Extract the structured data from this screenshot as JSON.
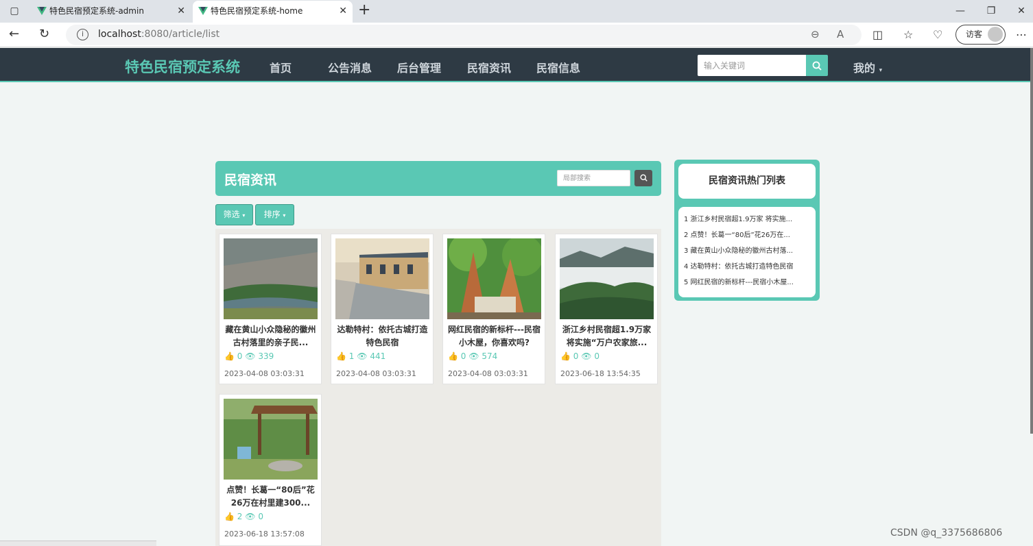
{
  "browser": {
    "tabs": [
      {
        "title": "特色民宿预定系统-admin"
      },
      {
        "title": "特色民宿预定系统-home"
      }
    ],
    "url_host": "localhost",
    "url_path": ":8080/article/list",
    "visitor_label": "访客"
  },
  "header": {
    "logo": "特色民宿预定系统",
    "nav": [
      "首页",
      "公告消息",
      "后台管理",
      "民宿资讯",
      "民宿信息"
    ],
    "search_placeholder": "输入关键词",
    "user_menu": "我的"
  },
  "section": {
    "title": "民宿资讯",
    "search_placeholder": "局部搜索",
    "filter_label": "筛选",
    "sort_label": "排序"
  },
  "articles": [
    {
      "title": "藏在黄山小众隐秘的徽州古村落里的亲子民...",
      "likes": "0",
      "views": "339",
      "date": "2023-04-08 03:03:31"
    },
    {
      "title": "达勒特村：依托古城打造特色民宿",
      "likes": "1",
      "views": "441",
      "date": "2023-04-08 03:03:31"
    },
    {
      "title": "网红民宿的新标杆---民宿小木屋，你喜欢吗?",
      "likes": "0",
      "views": "574",
      "date": "2023-04-08 03:03:31"
    },
    {
      "title": "浙江乡村民宿超1.9万家 将实施“万户农家旅...",
      "likes": "0",
      "views": "0",
      "date": "2023-06-18 13:54:35"
    },
    {
      "title": "点赞！长葛一“80后”花26万在村里建300...",
      "likes": "2",
      "views": "0",
      "date": "2023-06-18 13:57:08"
    }
  ],
  "sidebar": {
    "title": "民宿资讯热门列表",
    "items": [
      "1  浙江乡村民宿超1.9万家 将实施...",
      "2  点赞！长葛一“80后”花26万在...",
      "3  藏在黄山小众隐秘的徽州古村落...",
      "4  达勒特村：依托古城打造特色民宿",
      "5  网红民宿的新标杆---民宿小木屋..."
    ]
  },
  "watermark": "CSDN @q_3375686806",
  "colors": {
    "accent": "#5ac8b4",
    "header_bg": "#2e3a44"
  }
}
